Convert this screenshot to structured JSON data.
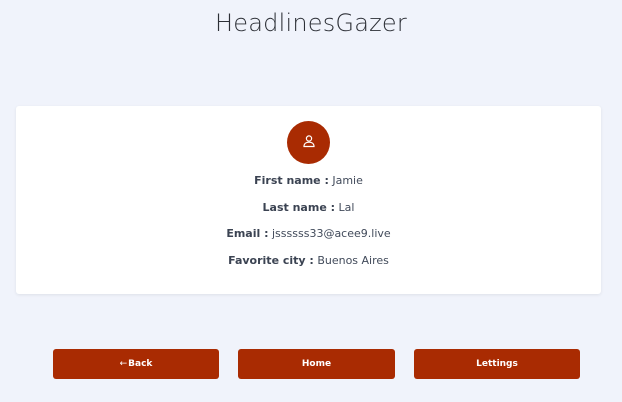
{
  "app": {
    "title": "HeadlinesGazer"
  },
  "profile": {
    "avatar_icon": "user-icon",
    "fields": [
      {
        "label": "First name :",
        "value": "Jamie"
      },
      {
        "label": "Last name :",
        "value": "Lal"
      },
      {
        "label": "Email :",
        "value": "jssssss33@acee9.live"
      },
      {
        "label": "Favorite city :",
        "value": "Buenos Aires"
      }
    ]
  },
  "nav": {
    "back_arrow": "←",
    "back_label": "Back",
    "home_label": "Home",
    "lettings_label": "Lettings"
  },
  "colors": {
    "accent": "#a92b02",
    "background": "#f0f3fb",
    "card": "#ffffff"
  }
}
